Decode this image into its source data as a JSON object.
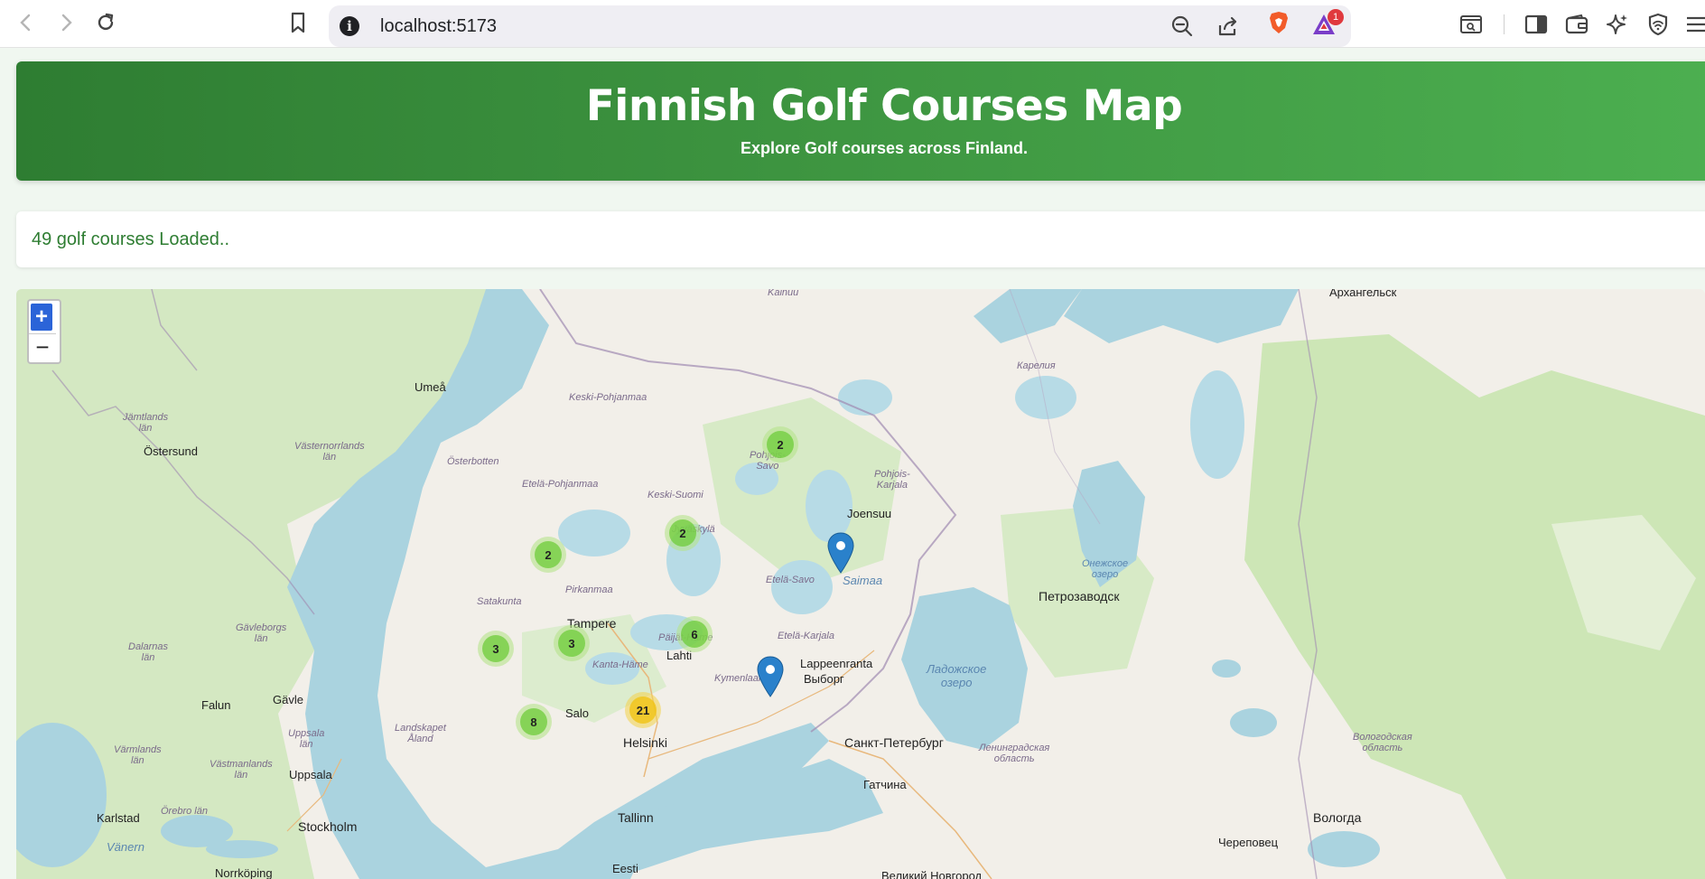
{
  "browser": {
    "url": "localhost:5173",
    "rewards_badge": "1"
  },
  "header": {
    "title": "Finnish Golf Courses Map",
    "subtitle": "Explore Golf courses across Finland."
  },
  "status": {
    "text": "49 golf courses Loaded.."
  },
  "map": {
    "zoom_in": "+",
    "zoom_out": "−",
    "clusters": [
      {
        "count": "2",
        "kind": "small"
      },
      {
        "count": "2",
        "kind": "small"
      },
      {
        "count": "2",
        "kind": "small"
      },
      {
        "count": "3",
        "kind": "small"
      },
      {
        "count": "3",
        "kind": "small"
      },
      {
        "count": "6",
        "kind": "small"
      },
      {
        "count": "8",
        "kind": "small"
      },
      {
        "count": "21",
        "kind": "medium"
      }
    ],
    "labels": {
      "arkhangelsk": "Архангельск",
      "kainuu": "Kainuu",
      "umea": "Umeå",
      "keski_pohjanmaa": "Keski-Pohjanmaa",
      "karelia": "Карелия",
      "jamtlands": "Jämtlands\nlän",
      "ostersund": "Östersund",
      "vasternorrlands": "Västernorrlands\nlän",
      "osterbotten": "Österbotten",
      "pohjois_savo": "Pohjois-\nSavo",
      "pohjois_karjala": "Pohjois-\nKarjala",
      "etela_pohjanmaa": "Etelä-Pohjanmaa",
      "keski_suomi": "Keski-Suomi",
      "joensuu": "Joensuu",
      "jyvaskyla": "Jyväskylä",
      "etela_savo": "Etelä-Savo",
      "saimaa": "Saimaa",
      "onezhskoe": "Онежское\nозеро",
      "petrozavodsk": "Петрозаводск",
      "pirkanmaa": "Pirkanmaa",
      "satakunta": "Satakunta",
      "tampere": "Tampere",
      "gavleborgs": "Gävleborgs\nlän",
      "dalarnas": "Dalarnas\nlän",
      "paijat_hame": "Päijät-Häme",
      "lahti": "Lahti",
      "etela_karjala": "Etelä-Karjala",
      "lappeenranta": "Lappeenranta",
      "kanta_hame": "Kanta-Häme",
      "kymenlaakso": "Kymenlaakso",
      "vyborg": "Выборг",
      "ladozhskoe": "Ладожское\nозеро",
      "falun": "Falun",
      "gavle": "Gävle",
      "landskapet_aland": "Landskapet\nÅland",
      "uppsala_lan": "Uppsala\nlän",
      "salo": "Salo",
      "helsinki": "Helsinki",
      "spb": "Санкт-Петербург",
      "leningradskaya": "Ленинградская\nобласть",
      "vologodskaya": "Вологодская\nобласть",
      "varmlands": "Värmlands\nlän",
      "vastmanlands": "Västmanlands\nlän",
      "uppsala": "Uppsala",
      "gatchina": "Гатчина",
      "karlstad": "Karlstad",
      "orebro": "Örebro län",
      "stockholm": "Stockholm",
      "tallinn": "Tallinn",
      "vologda": "Вологда",
      "cherepovets": "Череповец",
      "vanern": "Vänern",
      "norrkoping": "Norrköping",
      "eesti": "Eesti",
      "veliky": "Великий Новгород"
    }
  },
  "colors": {
    "header_start": "#2e7d32",
    "header_end": "#4caf50",
    "status_text": "#2e7d32",
    "water": "#aad3df",
    "land": "#f2efe9",
    "forest": "#cde6b6",
    "cluster_small": "#6ecc39",
    "cluster_medium": "#f0c20c",
    "marker": "#2a81cb"
  }
}
